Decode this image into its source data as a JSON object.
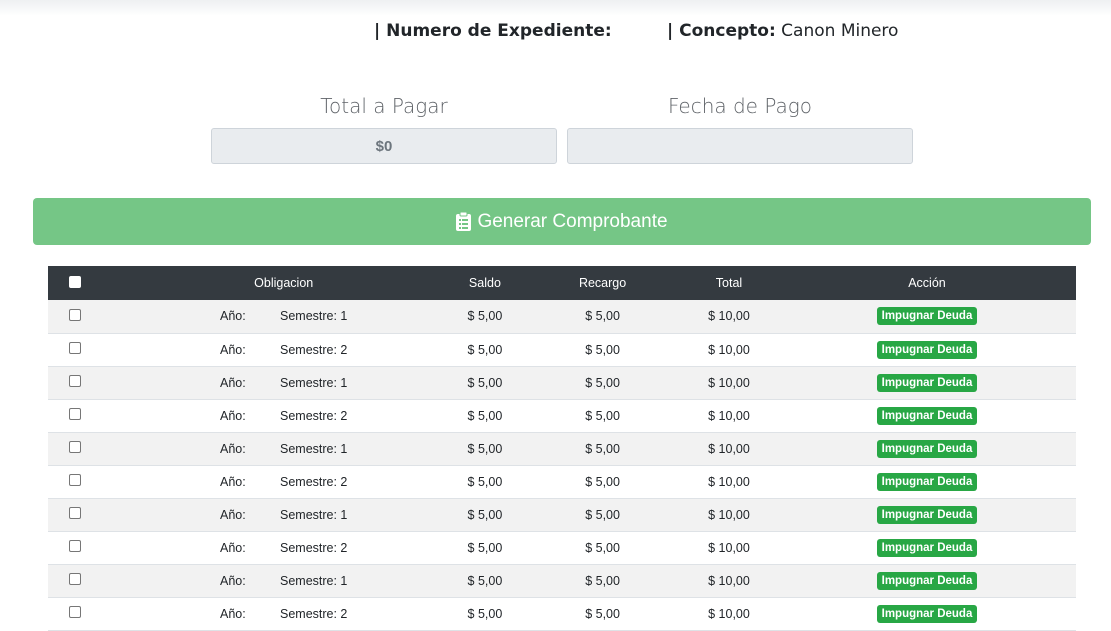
{
  "header": {
    "expediente_label": "| Numero de Expediente:",
    "expediente_value": "",
    "concepto_label": "| Concepto:",
    "concepto_value": "Canon Minero"
  },
  "fields": {
    "total_label": "Total a Pagar",
    "total_value": "$0",
    "fecha_label": "Fecha de Pago",
    "fecha_value": ""
  },
  "generate_button": {
    "label": "Generar Comprobante",
    "icon": "clipboard-icon",
    "color": "#75c686"
  },
  "table": {
    "columns": [
      "Obligacion",
      "Saldo",
      "Recargo",
      "Total",
      "Acción"
    ],
    "rows": [
      {
        "anio": "Año:",
        "semestre": "Semestre: 1",
        "saldo": "$ 5,00",
        "recargo": "$ 5,00",
        "total": "$ 10,00",
        "accion": "Impugnar Deuda"
      },
      {
        "anio": "Año:",
        "semestre": "Semestre: 2",
        "saldo": "$ 5,00",
        "recargo": "$ 5,00",
        "total": "$ 10,00",
        "accion": "Impugnar Deuda"
      },
      {
        "anio": "Año:",
        "semestre": "Semestre: 1",
        "saldo": "$ 5,00",
        "recargo": "$ 5,00",
        "total": "$ 10,00",
        "accion": "Impugnar Deuda"
      },
      {
        "anio": "Año:",
        "semestre": "Semestre: 2",
        "saldo": "$ 5,00",
        "recargo": "$ 5,00",
        "total": "$ 10,00",
        "accion": "Impugnar Deuda"
      },
      {
        "anio": "Año:",
        "semestre": "Semestre: 1",
        "saldo": "$ 5,00",
        "recargo": "$ 5,00",
        "total": "$ 10,00",
        "accion": "Impugnar Deuda"
      },
      {
        "anio": "Año:",
        "semestre": "Semestre: 2",
        "saldo": "$ 5,00",
        "recargo": "$ 5,00",
        "total": "$ 10,00",
        "accion": "Impugnar Deuda"
      },
      {
        "anio": "Año:",
        "semestre": "Semestre: 1",
        "saldo": "$ 5,00",
        "recargo": "$ 5,00",
        "total": "$ 10,00",
        "accion": "Impugnar Deuda"
      },
      {
        "anio": "Año:",
        "semestre": "Semestre: 2",
        "saldo": "$ 5,00",
        "recargo": "$ 5,00",
        "total": "$ 10,00",
        "accion": "Impugnar Deuda"
      },
      {
        "anio": "Año:",
        "semestre": "Semestre: 1",
        "saldo": "$ 5,00",
        "recargo": "$ 5,00",
        "total": "$ 10,00",
        "accion": "Impugnar Deuda"
      },
      {
        "anio": "Año:",
        "semestre": "Semestre: 2",
        "saldo": "$ 5,00",
        "recargo": "$ 5,00",
        "total": "$ 10,00",
        "accion": "Impugnar Deuda"
      }
    ]
  },
  "colors": {
    "table_header": "#343a40",
    "badge": "#28a745"
  }
}
